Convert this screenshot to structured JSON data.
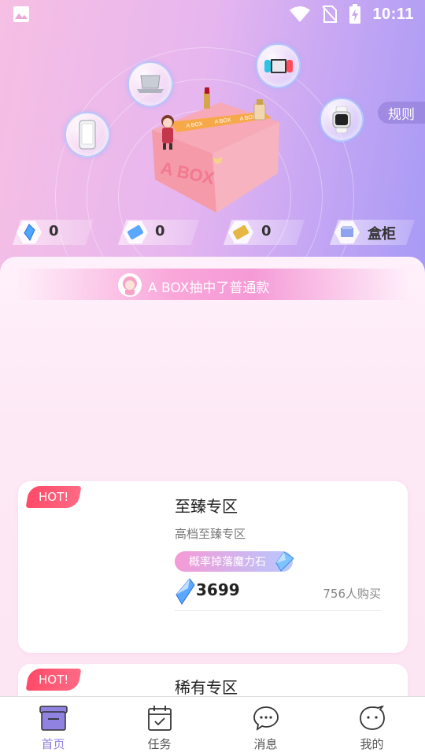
{
  "status_bar": {
    "time": "10:11"
  },
  "hero": {
    "rules_label": "规则",
    "box_brand_big": "A BOX",
    "box_tape_text": "A BOX",
    "currencies": [
      {
        "icon": "crystal-icon",
        "value": "0"
      },
      {
        "icon": "ticket-icon",
        "value": "0"
      },
      {
        "icon": "gold-card-icon",
        "value": "0"
      },
      {
        "icon": "cabinet-icon",
        "value": "盒柜"
      }
    ]
  },
  "marquee": {
    "text": "A BOX抽中了普通款"
  },
  "cards": [
    {
      "badge": "HOT!",
      "title": "至臻专区",
      "subtitle": "高档至臻专区",
      "tag": "概率掉落魔力石",
      "price": "3699",
      "buyers": "756人购买"
    },
    {
      "badge": "HOT!",
      "title": "稀有专区"
    }
  ],
  "bottom_nav": [
    {
      "label": "首页",
      "active": true
    },
    {
      "label": "任务",
      "active": false
    },
    {
      "label": "消息",
      "active": false
    },
    {
      "label": "我的",
      "active": false
    }
  ],
  "colors": {
    "accent": "#8f82e0",
    "hot": "#ff4a68",
    "marquee": "#f59ad6",
    "panel": "#fde9f6"
  }
}
